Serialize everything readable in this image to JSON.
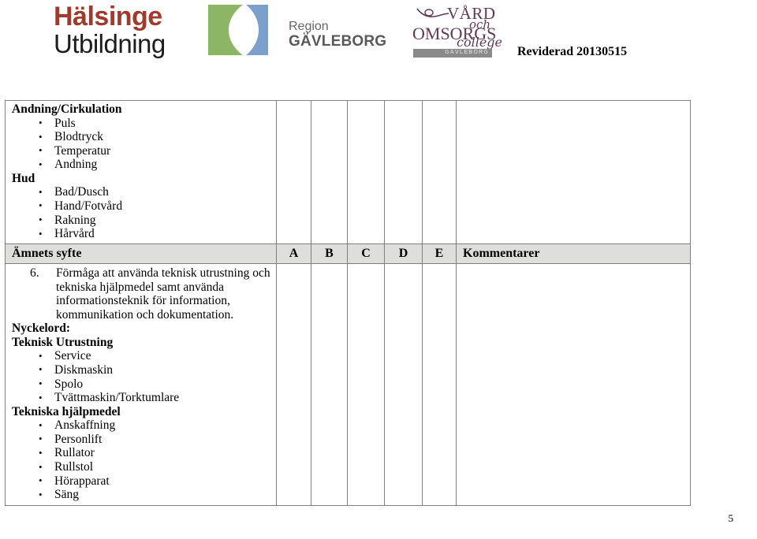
{
  "header": {
    "logos": {
      "halsinge": {
        "line1": "Hälsinge",
        "line2": "Utbildning",
        "accent_color": "#9e3b2c",
        "text_color": "#1d1d1d"
      },
      "region": {
        "line1": "Region",
        "line2": "GÄVLEBORG",
        "mark_green": "#8cb566",
        "mark_blue": "#7d9fcc",
        "text_color": "#5f5f5f"
      },
      "vard_omsorgs_college": {
        "word1": "VÅRD",
        "word2": "och",
        "word3": "OMSORGS",
        "word4": "college",
        "bar_label": "GÄVLEBORG",
        "color": "#5d3b52",
        "bar_color": "#8a8a8a"
      }
    },
    "revision_stamp": "Reviderad 20130515"
  },
  "continuation_table": {
    "sections": [
      {
        "heading": "Andning/Cirkulation",
        "items": [
          "Puls",
          "Blodtryck",
          "Temperatur",
          "Andning"
        ]
      },
      {
        "heading": "Hud",
        "items": [
          "Bad/Dusch",
          "Hand/Fotvård",
          "Rakning",
          "Hårvård"
        ]
      }
    ],
    "grade_cells": [
      "",
      "",
      "",
      "",
      ""
    ],
    "comment_cell": ""
  },
  "main_table": {
    "header": {
      "purpose": "Ämnets syfte",
      "grades": [
        "A",
        "B",
        "C",
        "D",
        "E"
      ],
      "comments": "Kommentarer",
      "background_color": "#dededd"
    },
    "row": {
      "aim_number": "6.",
      "aim_text": "Förmåga att använda teknisk utrustning och tekniska hjälpmedel samt använda informationsteknik för information, kommunikation och dokumentation.",
      "keywords_label": "Nyckelord:",
      "sections": [
        {
          "heading": "Teknisk Utrustning",
          "items": [
            "Service",
            "Diskmaskin",
            "Spolo",
            "Tvättmaskin/Torktumlare"
          ]
        },
        {
          "heading": "Tekniska hjälpmedel",
          "items": [
            "Anskaffning",
            "Personlift",
            "Rullator",
            "Rullstol",
            "Hörapparat",
            "Säng"
          ]
        }
      ],
      "grade_cells": [
        "",
        "",
        "",
        "",
        ""
      ],
      "comment_cell": ""
    }
  },
  "footer": {
    "page_number": "5"
  }
}
